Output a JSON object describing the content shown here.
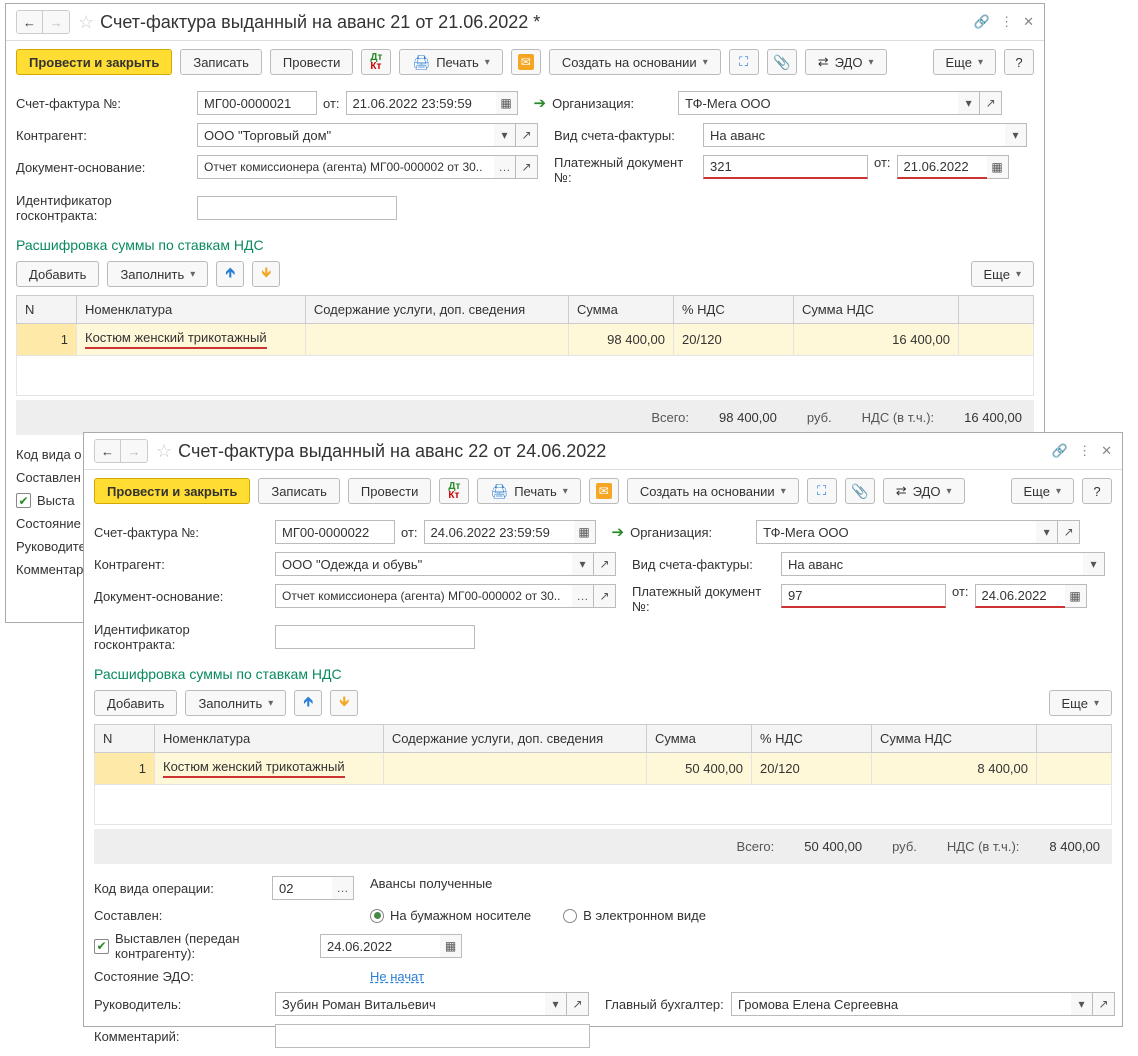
{
  "toolbar_labels": {
    "post_close": "Провести и закрыть",
    "write": "Записать",
    "post": "Провести",
    "print": "Печать",
    "base": "Создать на основании",
    "edo": "ЭДО",
    "more": "Еще"
  },
  "labels": {
    "invoice_no": "Счет-фактура №:",
    "from": "от:",
    "org": "Организация:",
    "kontr": "Контрагент:",
    "invoice_type": "Вид счета-фактуры:",
    "base_doc": "Документ-основание:",
    "pay_doc": "Платежный документ №:",
    "gos_id": "Идентификатор госконтракта:",
    "breakdown": "Расшифровка суммы по ставкам НДС",
    "add": "Добавить",
    "fill": "Заполнить",
    "total": "Всего:",
    "rub": "руб.",
    "nds_incl": "НДС (в т.ч.):",
    "op_code": "Код вида операции:",
    "adv_recv": "Авансы полученные",
    "composed": "Составлен:",
    "paper": "На бумажном носителе",
    "electronic": "В электронном виде",
    "issued": "Выставлен (передан контрагенту):",
    "edo_state": "Состояние ЭДО:",
    "not_started": "Не начат",
    "director": "Руководитель:",
    "chief_acc": "Главный бухгалтер:",
    "comment": "Комментарий:"
  },
  "table_headers": {
    "n": "N",
    "nomen": "Номенклатура",
    "content": "Содержание услуги, доп. сведения",
    "sum": "Сумма",
    "nds_rate": "% НДС",
    "nds_sum": "Сумма НДС"
  },
  "common": {
    "org": "ТФ-Мега ООО",
    "invoice_type": "На аванс",
    "base_doc": "Отчет комиссионера (агента) МГ00-000002 от 30..",
    "nomen": "Костюм женский трикотажный",
    "nds_rate": "20/120",
    "op_code": "02",
    "director": "Зубин Роман Витальевич",
    "chief_acc": "Громова Елена Сергеевна"
  },
  "w1": {
    "title": "Счет-фактура выданный на аванс 21 от 21.06.2022 *",
    "invoice_no": "МГ00-0000021",
    "date": "21.06.2022 23:59:59",
    "kontr": "ООО \"Торговый дом\"",
    "pay_no": "321",
    "pay_date": "21.06.2022",
    "row_n": "1",
    "sum": "98 400,00",
    "nds_sum": "16 400,00"
  },
  "w2": {
    "title": "Счет-фактура выданный на аванс 22 от 24.06.2022",
    "invoice_no": "МГ00-0000022",
    "date": "24.06.2022 23:59:59",
    "kontr": "ООО \"Одежда и обувь\"",
    "pay_no": "97",
    "pay_date": "24.06.2022",
    "row_n": "1",
    "sum": "50 400,00",
    "nds_sum": "8 400,00",
    "issued_date": "24.06.2022"
  },
  "truncated_labels": {
    "op_code": "Код вида о",
    "composed": "Составлен",
    "issued_chk": "Выста",
    "edo_state": "Состояние",
    "director": "Руководите",
    "comment": "Комментар"
  }
}
